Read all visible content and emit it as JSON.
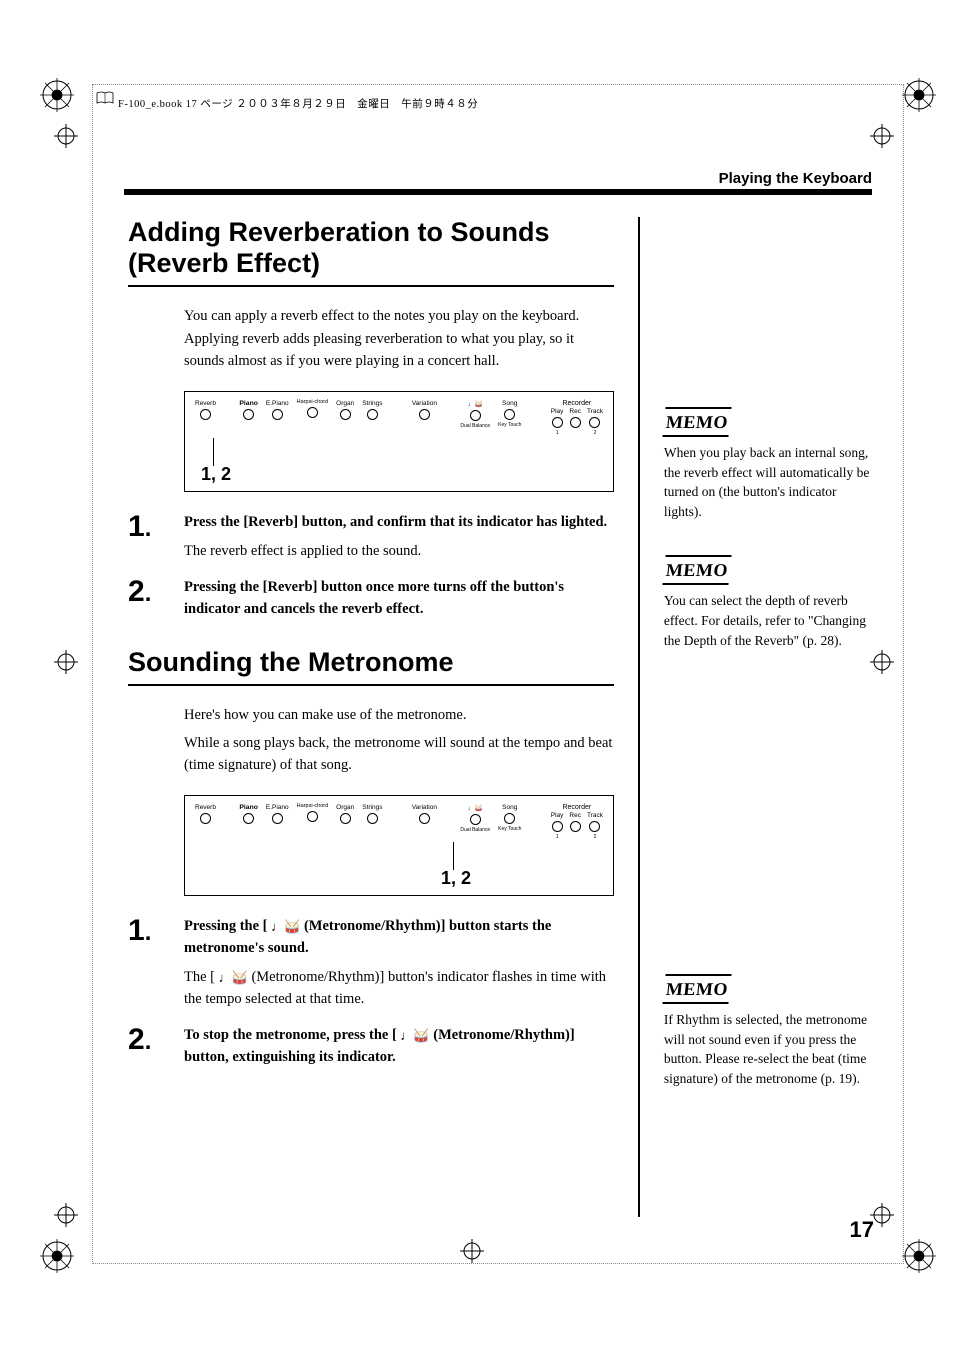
{
  "print_header": "F-100_e.book  17 ページ  ２００３年８月２９日　金曜日　午前９時４８分",
  "running_head": "Playing the Keyboard",
  "section1": {
    "title": "Adding Reverberation to Sounds (Reverb Effect)",
    "intro": "You can apply a reverb effect to the notes you play on the keyboard. Applying reverb adds pleasing reverberation to what you play, so it sounds almost as if you were playing in a concert hall.",
    "panel_callout": "1, 2",
    "steps": [
      {
        "num": "1",
        "lead": "Press the [Reverb] button, and confirm that its indicator has lighted.",
        "after": "The reverb effect is applied to the sound."
      },
      {
        "num": "2",
        "lead": "Pressing the [Reverb] button once more turns off the button's indicator and cancels the reverb effect.",
        "after": ""
      }
    ]
  },
  "section2": {
    "title": "Sounding the Metronome",
    "intro1": "Here's how you can make use of the metronome.",
    "intro2": "While a song plays back, the metronome will sound at the tempo and beat (time signature) of that song.",
    "panel_callout": "1, 2",
    "steps": [
      {
        "num": "1",
        "lead_pre": "Pressing the [ ",
        "lead_post": " (Metronome/Rhythm)] button starts the metronome's sound.",
        "after_pre": "The [ ",
        "after_post": " (Metronome/Rhythm)] button's indicator flashes in time with the tempo selected at that time."
      },
      {
        "num": "2",
        "lead_pre": "To stop the metronome, press the [ ",
        "lead_post": " (Metronome/Rhythm)] button, extinguishing its indicator."
      }
    ]
  },
  "memos": {
    "label": "MEMO",
    "m1": "When you play back an internal song, the reverb effect will automatically be turned on (the button's indicator lights).",
    "m2": "You can select the depth of reverb effect. For details, refer to \"Changing the Depth of the Reverb\" (p. 28).",
    "m3": "If Rhythm is selected, the metronome will not sound even if you press the button. Please re-select the beat (time signature) of the metronome (p. 19)."
  },
  "panel_labels": {
    "reverb": "Reverb",
    "piano": "Piano",
    "epiano": "E.Piano",
    "harpsi": "Harpsi-chord",
    "organ": "Organ",
    "strings": "Strings",
    "variation": "Variation",
    "metronome_icon": "♩🥁",
    "song": "Song",
    "dual": "Dual Balance",
    "keytouch": "Key Touch",
    "recorder": "Recorder",
    "play": "Play",
    "rec": "Rec",
    "track": "Track",
    "one": "1",
    "two": "2"
  },
  "page_number": "17"
}
